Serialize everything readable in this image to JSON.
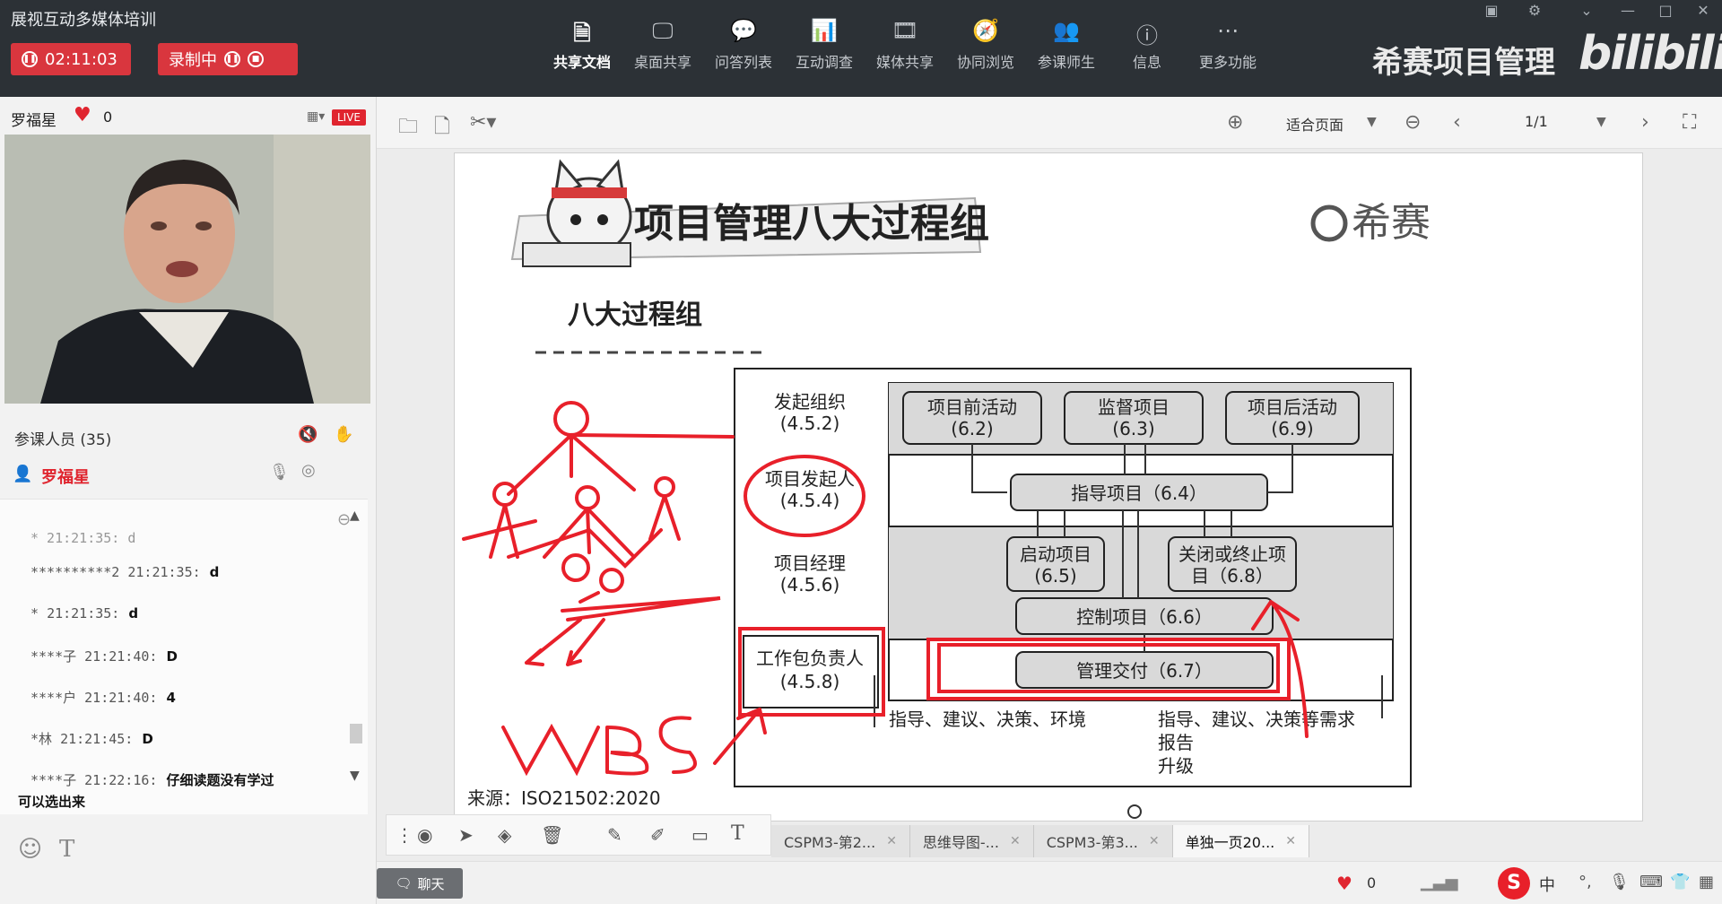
{
  "app": {
    "title": "展视互动多媒体培训"
  },
  "top": {
    "timer": "02:11:03",
    "recording_label": "录制中",
    "toolbar": [
      {
        "label": "共享文档",
        "icon": "document-icon"
      },
      {
        "label": "桌面共享",
        "icon": "desktop-share-icon"
      },
      {
        "label": "问答列表",
        "icon": "qa-icon"
      },
      {
        "label": "互动调查",
        "icon": "poll-icon"
      },
      {
        "label": "媒体共享",
        "icon": "media-icon"
      },
      {
        "label": "协同浏览",
        "icon": "browse-icon"
      },
      {
        "label": "参课师生",
        "icon": "people-icon"
      },
      {
        "label": "信息",
        "icon": "info-icon"
      },
      {
        "label": "更多功能",
        "icon": "more-icon"
      }
    ],
    "brand": "希赛项目管理",
    "bili_logo": "bilibili"
  },
  "left": {
    "presenter": "罗福星",
    "likes": "0",
    "live_badge": "LIVE",
    "participants_label": "参课人员 (35)",
    "host_name": "罗福星",
    "chat": [
      {
        "user": "**********2",
        "time": "21:21:35:",
        "text": "d"
      },
      {
        "user": "*",
        "time": "21:21:35:",
        "text": "d"
      },
      {
        "user": "****子",
        "time": "21:21:40:",
        "text": "D"
      },
      {
        "user": "****户",
        "time": "21:21:40:",
        "text": "4"
      },
      {
        "user": "*林",
        "time": "21:21:45:",
        "text": "D"
      },
      {
        "user": "****子",
        "time": "21:22:16:",
        "text": "仔细读题没有学过"
      }
    ],
    "chat_continuation": "可以选出来",
    "chat_partial_top": "* 21:21:35: d",
    "text_tool": "T"
  },
  "main": {
    "zoom": "适合页面",
    "page": "1/1"
  },
  "slide": {
    "title": "项目管理八大过程组",
    "subtitle": "八大过程组",
    "logo_text": "希赛",
    "source": "来源：ISO21502:2020",
    "roles": [
      {
        "name": "发起组织",
        "code": "(4.5.2)"
      },
      {
        "name": "项目发起人",
        "code": "(4.5.4)"
      },
      {
        "name": "项目经理",
        "code": "(4.5.6)"
      },
      {
        "name": "工作包负责人",
        "code": "(4.5.8)"
      }
    ],
    "processes": {
      "pre": {
        "name": "项目前活动",
        "code": "(6.2)"
      },
      "supervise": {
        "name": "监督项目",
        "code": "(6.3)"
      },
      "post": {
        "name": "项目后活动",
        "code": "(6.9)"
      },
      "direct": "指导项目（6.4）",
      "start": {
        "name": "启动项目",
        "code": "(6.5)"
      },
      "close": {
        "name": "关闭或终止项",
        "name2": "目（6.8）"
      },
      "control": "控制项目（6.6）",
      "deliver": "管理交付（6.7）"
    },
    "down_note": "指导、建议、决策、环境",
    "up_note_1": "指导、建议、决策等需求",
    "up_note_2": "报告",
    "up_note_3": "升级",
    "annotation_wbs": "WBS"
  },
  "tabs": [
    {
      "label": "CSPM3-第2..."
    },
    {
      "label": "思维导图-..."
    },
    {
      "label": "CSPM3-第3..."
    },
    {
      "label": "单独一页20..."
    }
  ],
  "status": {
    "chat_button": "聊天",
    "likes": "0",
    "ime": "中"
  },
  "colors": {
    "topbar": "#2c3136",
    "record_red": "#d9363e",
    "annotation_red": "#e8202a",
    "box_gray": "#d9d9d9"
  }
}
